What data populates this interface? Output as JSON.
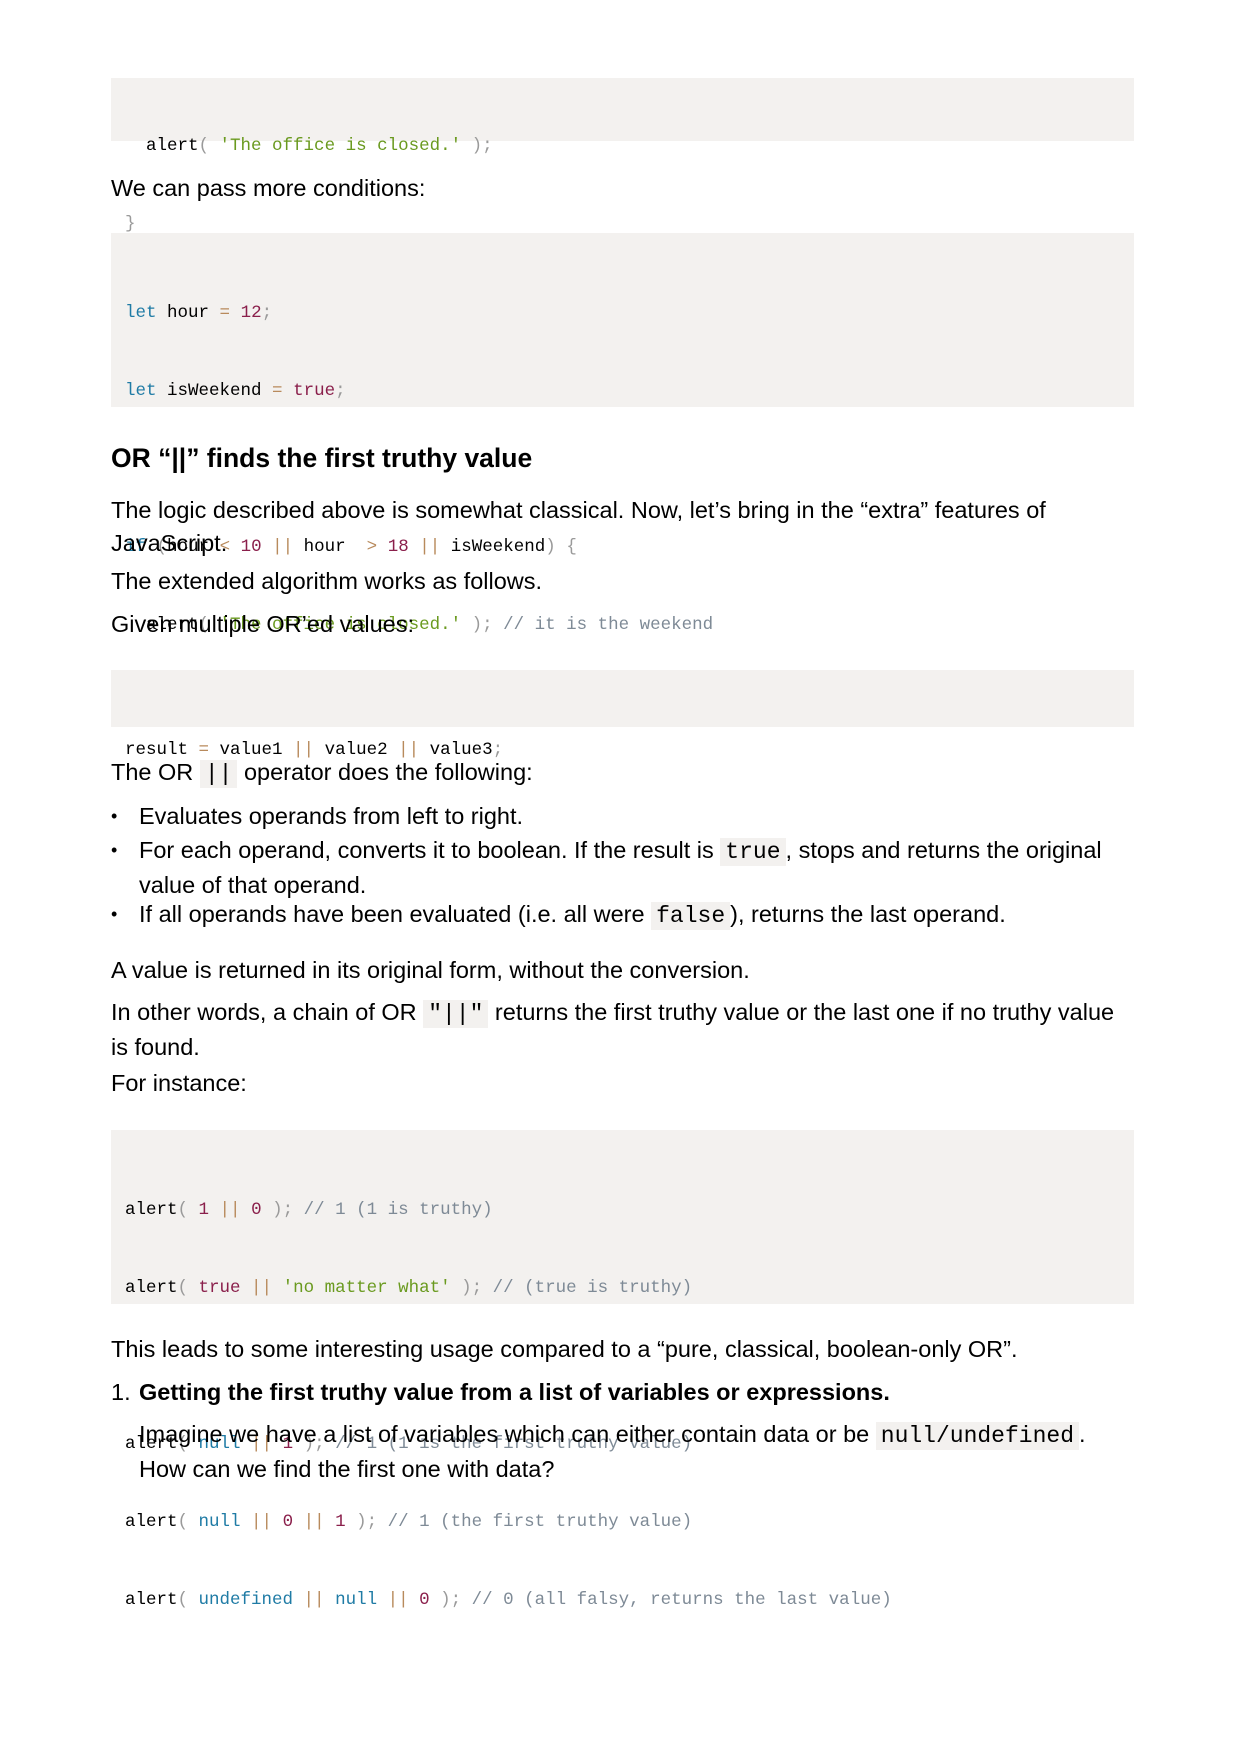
{
  "code_top": {
    "line1": {
      "fn": "alert",
      "open": "( ",
      "str": "'The office is closed.'",
      "close": " );"
    },
    "line2": {
      "brace": "}"
    }
  },
  "para_more_conditions": "We can pass more conditions:",
  "code_conditions": {
    "l1": {
      "kw": "let",
      "name": " hour ",
      "op": "=",
      "sp": " ",
      "num": "12",
      "end": ";"
    },
    "l2": {
      "kw": "let",
      "name": " isWeekend ",
      "op": "=",
      "sp": " ",
      "val": "true",
      "end": ";"
    },
    "l3": {
      "kw": "if",
      "sp1": " ",
      "paren": "(",
      "a": "hour ",
      "lt": "<",
      "sp2": " ",
      "n10": "10",
      "sp3": " ",
      "or1": "||",
      "b": " hour ",
      "gt": ">",
      "sp4": " ",
      "n18": "18",
      "sp5": " ",
      "or2": "||",
      "c": " isWeekend",
      "close": ")",
      "sp6": " ",
      "brace": "{"
    },
    "l4": {
      "fn": "alert",
      "open": "( ",
      "str": "'The office is closed.'",
      "close": " );",
      "comment": " // it is the weekend"
    },
    "l5": {
      "brace": "}"
    }
  },
  "heading_or": "OR “||” finds the first truthy value",
  "para_logic_1": "The logic described above is somewhat classical. Now, let’s bring in the “extra” features of",
  "para_logic_2": "JavaScript.",
  "para_extended": "The extended algorithm works as follows.",
  "para_given": "Given multiple OR’ed values:",
  "code_result": {
    "name": "result ",
    "eq": "=",
    "v1": " value1 ",
    "or1": "||",
    "v2": " value2 ",
    "or2": "||",
    "v3": " value3",
    "end": ";"
  },
  "para_operator": {
    "pre": "The OR ",
    "code": "||",
    "post": " operator does the following:"
  },
  "bullets": {
    "b1": "Evaluates operands from left to right.",
    "b2_pre": "For each operand, converts it to boolean. If the result is ",
    "b2_code": "true",
    "b2_post": ", stops and returns the original",
    "b2_line2": "value of that operand.",
    "b3_pre": "If all operands have been evaluated (i.e. all were ",
    "b3_code": "false",
    "b3_post": "), returns the last operand."
  },
  "bullet_symbol": "•",
  "para_value_returned": "A value is returned in its original form, without the conversion.",
  "para_other_words": {
    "pre": "In other words, a chain of OR ",
    "code": "\"||\"",
    "post": " returns the first truthy value or the last one if no truthy value",
    "line2": "is found."
  },
  "para_instance": "For instance:",
  "code_examples": {
    "e1": {
      "fn": "alert",
      "open": "( ",
      "a": "1",
      "or": " || ",
      "b": "0",
      "close": " );",
      "comment": " // 1 (1 is truthy)"
    },
    "e2": {
      "fn": "alert",
      "open": "( ",
      "a": "true",
      "or": " || ",
      "b": "'no matter what'",
      "close": " );",
      "comment": " // (true is truthy)"
    },
    "e3": {
      "fn": "alert",
      "open": "( ",
      "a": "null",
      "or": " || ",
      "b": "1",
      "close": " );",
      "comment": " // 1 (1 is the first truthy value)"
    },
    "e4": {
      "fn": "alert",
      "open": "( ",
      "a": "null",
      "or1": " || ",
      "b": "0",
      "or2": " || ",
      "c": "1",
      "close": " );",
      "comment": " // 1 (the first truthy value)"
    },
    "e5": {
      "fn": "alert",
      "open": "( ",
      "a": "undefined",
      "or1": " || ",
      "b": "null",
      "or2": " || ",
      "c": "0",
      "close": " );",
      "comment": " // 0 (all falsy, returns the last value)"
    }
  },
  "para_leads": "This leads to some interesting usage compared to a “pure, classical, boolean-only OR”.",
  "ol": {
    "num": "1.",
    "title": "Getting the first truthy value from a list of variables or expressions.",
    "desc_pre": "Imagine we have a list of variables which can either contain data or be ",
    "desc_code": "null/undefined",
    "desc_post": ".",
    "desc_line2": "How can we find the first one with data?"
  }
}
